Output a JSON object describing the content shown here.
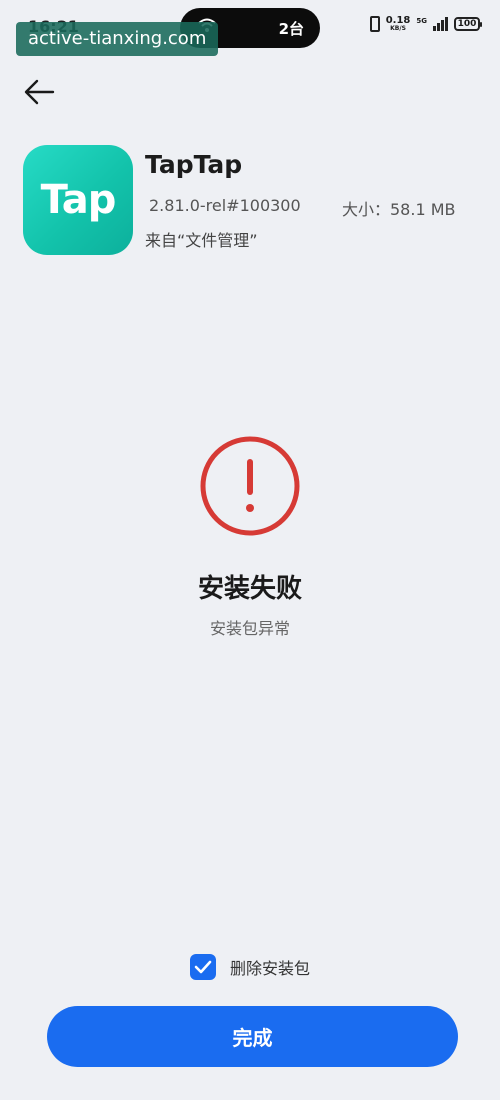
{
  "status_bar": {
    "time": "16:21",
    "island_count": "2台",
    "net_speed_value": "0.18",
    "net_speed_unit": "KB/S",
    "network_type": "5G",
    "battery": "100"
  },
  "watermark": "active-tianxing.com",
  "app": {
    "name": "TapTap",
    "icon_text": "Tap",
    "version": "2.81.0-rel#100300",
    "size": "大小：58.1 MB",
    "source": "来自“文件管理”"
  },
  "result": {
    "title": "安装失败",
    "subtitle": "安装包异常"
  },
  "delete_package": {
    "label": "删除安装包",
    "checked": true
  },
  "done_button": "完成",
  "colors": {
    "accent": "#1a6cf0",
    "error": "#d63a35",
    "app_icon": "#13c3ab",
    "background": "#eef0f4"
  },
  "icons": [
    "back-arrow-icon",
    "error-exclamation-icon",
    "checkmark-icon",
    "wifi-icon",
    "signal-icon",
    "battery-icon"
  ]
}
